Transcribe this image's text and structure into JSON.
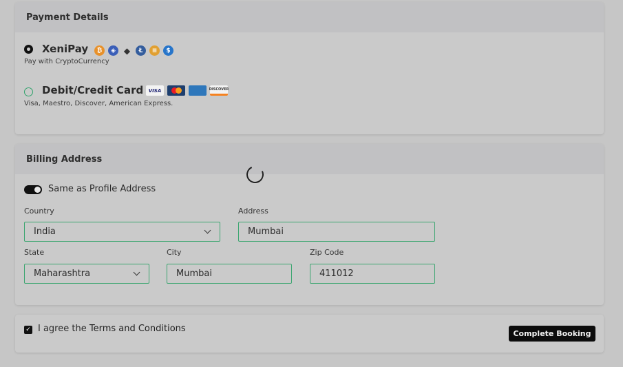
{
  "payment": {
    "header": "Payment Details",
    "options": [
      {
        "title": "XeniPay",
        "subtitle": "Pay with CryptoCurrency",
        "selected": true,
        "icons": [
          "bitcoin-icon",
          "coin-blue-icon",
          "ethereum-icon",
          "litecoin-icon",
          "coin-orange-icon",
          "usdc-icon"
        ]
      },
      {
        "title": "Debit/Credit Card",
        "subtitle": "Visa, Maestro, Discover, American Express.",
        "selected": false,
        "logos": {
          "visa": "VISA",
          "mastercard": "",
          "amex": "",
          "discover": "DISCOVER"
        }
      }
    ]
  },
  "billing": {
    "header": "Billing Address",
    "same_as_profile": "Same as Profile Address",
    "same_as_profile_on": true,
    "country": {
      "label": "Country",
      "value": "India"
    },
    "address": {
      "label": "Address",
      "value": "Mumbai"
    },
    "state": {
      "label": "State",
      "value": "Maharashtra"
    },
    "city": {
      "label": "City",
      "value": "Mumbai"
    },
    "zip": {
      "label": "Zip Code",
      "value": "411012"
    }
  },
  "agree": {
    "prefix": "I agree the ",
    "link": "Terms and Conditions",
    "checked": true
  },
  "actions": {
    "complete_booking": "Complete Booking"
  },
  "colors": {
    "accent_green": "#3aa56f",
    "button_bg": "#0c0c0c",
    "bitcoin": "#e8912a",
    "litecoin": "#345d9d",
    "usdc": "#2775ca"
  }
}
